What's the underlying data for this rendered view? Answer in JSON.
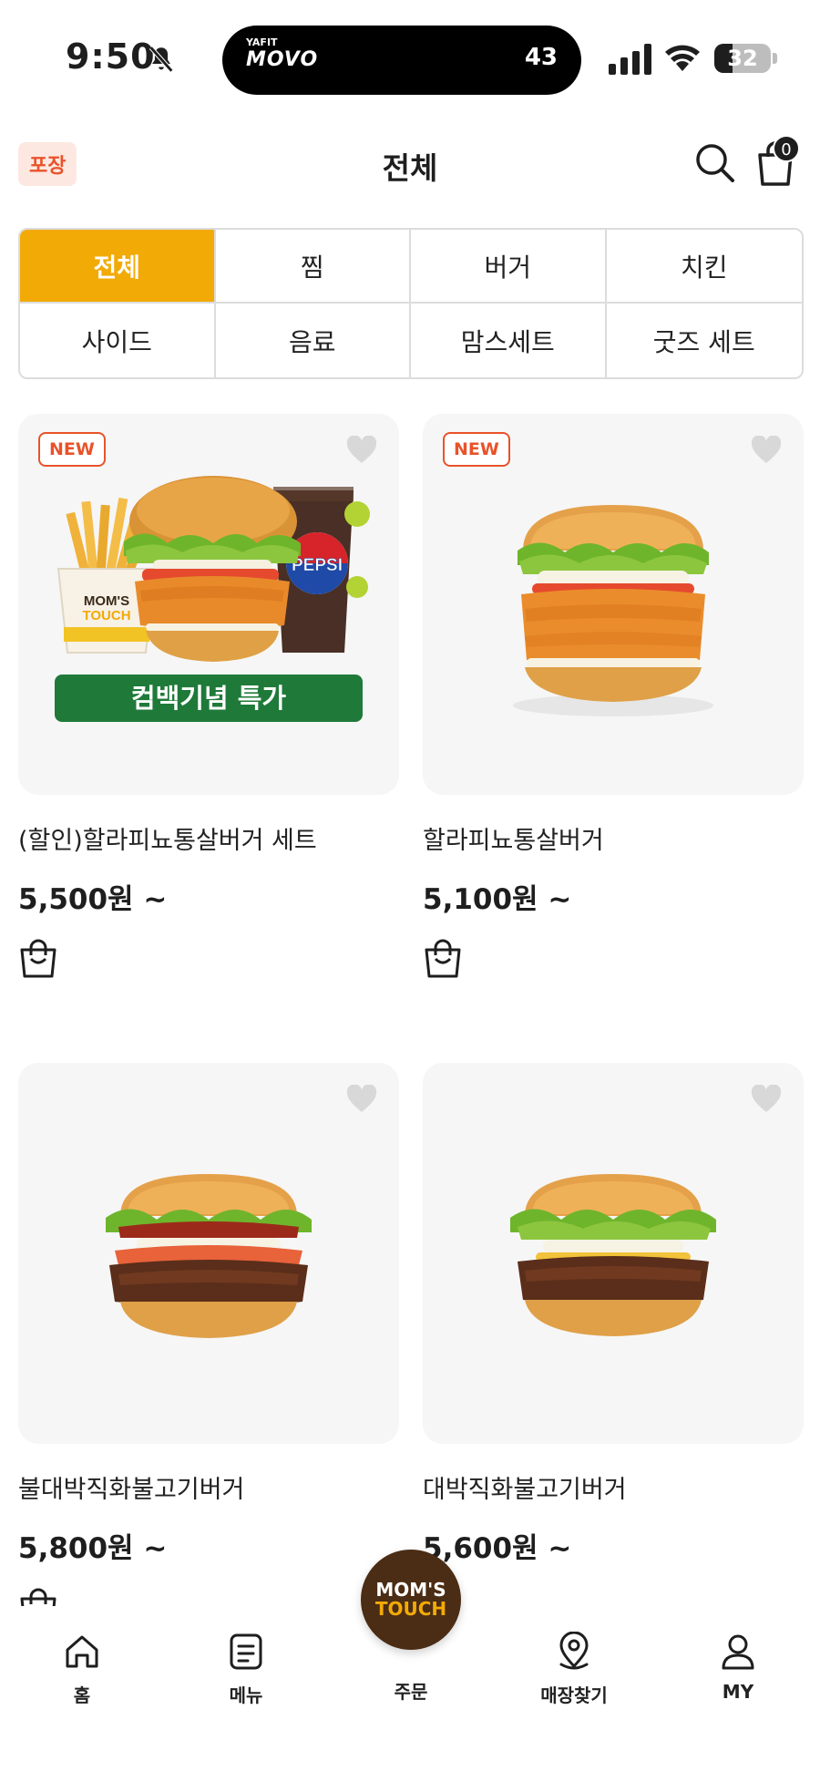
{
  "status_bar": {
    "time": "9:50",
    "island_app_small": "YAFIT",
    "island_app_big": "MOVO",
    "island_count": "43",
    "battery_level": 32,
    "battery_text": "32"
  },
  "header": {
    "order_type": "포장",
    "title": "전체",
    "cart_count": "0"
  },
  "categories": [
    {
      "label": "전체",
      "active": true
    },
    {
      "label": "찜",
      "active": false
    },
    {
      "label": "버거",
      "active": false
    },
    {
      "label": "치킨",
      "active": false
    },
    {
      "label": "사이드",
      "active": false
    },
    {
      "label": "음료",
      "active": false
    },
    {
      "label": "맘스세트",
      "active": false
    },
    {
      "label": "굿즈 세트",
      "active": false
    }
  ],
  "products": [
    {
      "name": "(할인)할라피뇨통살버거 세트",
      "price": "5,500원 ~",
      "badge": "NEW",
      "banner": "컴백기념 특가",
      "image": "set"
    },
    {
      "name": "할라피뇨통살버거",
      "price": "5,100원 ~",
      "badge": "NEW",
      "banner": "",
      "image": "chicken-burger"
    },
    {
      "name": "불대박직화불고기버거",
      "price": "5,800원 ~",
      "badge": "",
      "banner": "",
      "image": "spicy-bulgogi-burger"
    },
    {
      "name": "대박직화불고기버거",
      "price": "5,600원 ~",
      "badge": "",
      "banner": "",
      "image": "bulgogi-burger"
    }
  ],
  "image_text": {
    "bag_label_top": "MOM'S",
    "bag_label_bottom": "TOUCH",
    "cup_brand": "PEPSI"
  },
  "bottom_nav": {
    "home": "홈",
    "menu": "메뉴",
    "order": "주문",
    "store_finder": "매장찾기",
    "my": "MY",
    "logo_line1": "MOM'S",
    "logo_line2": "TOUCH"
  },
  "colors": {
    "accent": "#f2aa06",
    "badge": "#e8532a",
    "banner": "#1f7a3a",
    "brand_brown": "#4b2c14"
  }
}
